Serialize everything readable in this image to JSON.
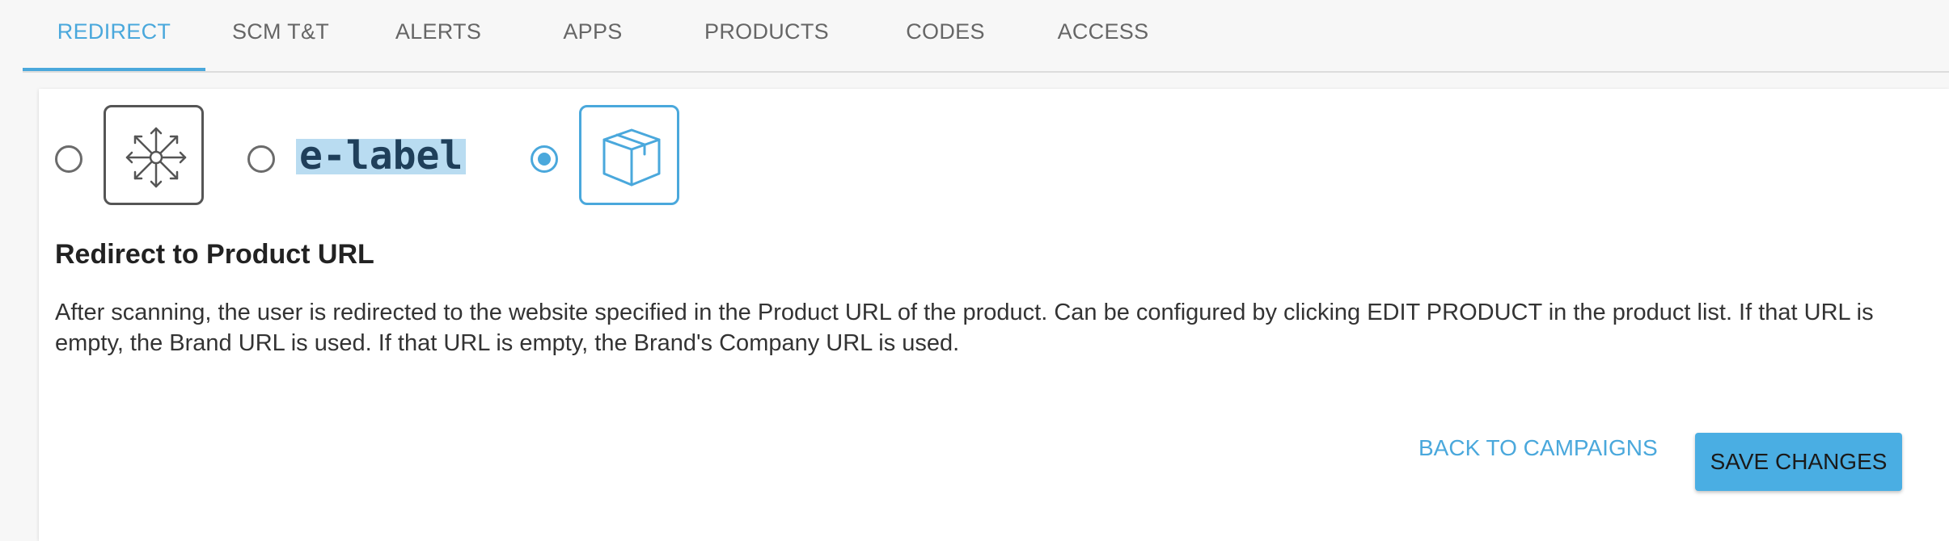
{
  "tabs": [
    {
      "label": "REDIRECT",
      "active": true
    },
    {
      "label": "SCM T&T",
      "active": false
    },
    {
      "label": "ALERTS",
      "active": false
    },
    {
      "label": "APPS",
      "active": false
    },
    {
      "label": "PRODUCTS",
      "active": false
    },
    {
      "label": "CODES",
      "active": false
    },
    {
      "label": "ACCESS",
      "active": false
    }
  ],
  "options": {
    "selected": "product",
    "items": [
      {
        "id": "redirect",
        "icon": "arrows-expand-icon",
        "checked": false
      },
      {
        "id": "elabel",
        "icon": "e-label-logo",
        "text": "e-label",
        "checked": false
      },
      {
        "id": "product",
        "icon": "box-icon",
        "checked": true
      }
    ]
  },
  "content": {
    "heading": "Redirect to Product URL",
    "description": "After scanning, the user is redirected to the website specified in the Product URL of the product. Can be configured by clicking EDIT PRODUCT in the product list. If that URL is empty, the Brand URL is used. If that URL is empty, the Brand's Company URL is used."
  },
  "footer": {
    "back_label": "BACK TO CAMPAIGNS",
    "save_label": "SAVE CHANGES"
  },
  "colors": {
    "accent": "#4aa8dc",
    "button": "#4aaee3",
    "highlight": "#b9dcf1"
  }
}
